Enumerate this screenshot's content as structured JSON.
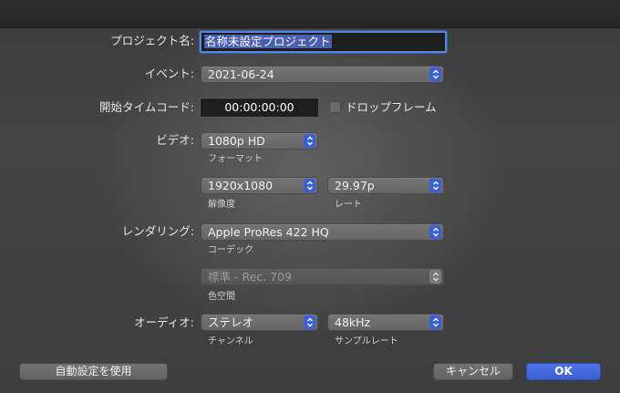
{
  "project": {
    "label": "プロジェクト名:",
    "value": "名称未設定プロジェクト"
  },
  "event": {
    "label": "イベント:",
    "value": "2021-06-24"
  },
  "timecode": {
    "label": "開始タイムコード:",
    "value": "00:00:00:00",
    "dropframe_label": "ドロップフレーム"
  },
  "video": {
    "label": "ビデオ:",
    "format": "1080p HD",
    "format_caption": "フォーマット",
    "resolution": "1920x1080",
    "resolution_caption": "解像度",
    "rate": "29.97p",
    "rate_caption": "レート"
  },
  "rendering": {
    "label": "レンダリング:",
    "codec": "Apple ProRes 422 HQ",
    "codec_caption": "コーデック",
    "color_space": "標準 - Rec. 709",
    "color_space_caption": "色空間"
  },
  "audio": {
    "label": "オーディオ:",
    "channels": "ステレオ",
    "channels_caption": "チャンネル",
    "sample_rate": "48kHz",
    "sample_rate_caption": "サンプルレート"
  },
  "buttons": {
    "auto": "自動設定を使用",
    "cancel": "キャンセル",
    "ok": "OK"
  },
  "colors": {
    "accent": "#3b5fd6",
    "background": "#404040",
    "field": "#1e1e1e"
  }
}
